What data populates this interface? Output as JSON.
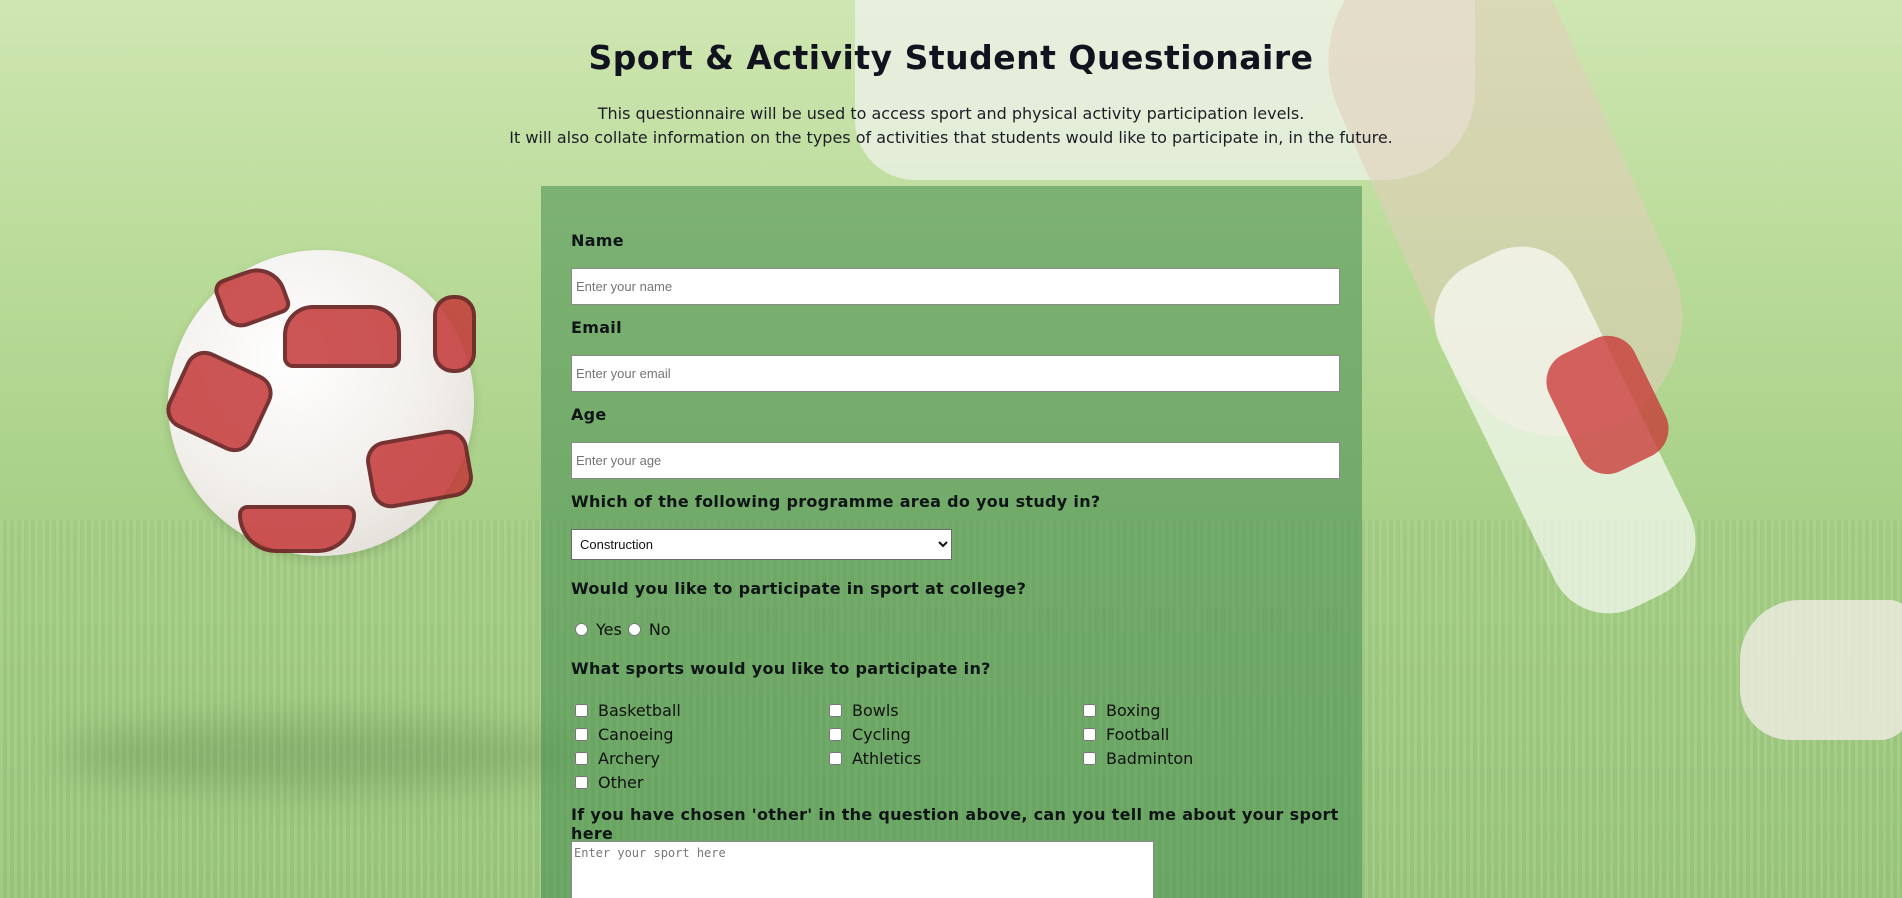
{
  "header": {
    "title": "Sport & Activity Student Questionaire",
    "subtitle_line1": "This questionnaire will be used to access sport and physical activity participation levels.",
    "subtitle_line2": "It will also collate information on the types of activities that students would like to participate in, in the future."
  },
  "form": {
    "name": {
      "label": "Name",
      "placeholder": "Enter your name"
    },
    "email": {
      "label": "Email",
      "placeholder": "Enter your email"
    },
    "age": {
      "label": "Age",
      "placeholder": "Enter your age"
    },
    "programme": {
      "label": "Which of the following programme area do you study in?",
      "selected": "Construction"
    },
    "participate": {
      "label": "Would you like to participate in sport at college?",
      "options": [
        "Yes",
        "No"
      ]
    },
    "sports": {
      "label": "What sports would you like to participate in?",
      "options": [
        "Basketball",
        "Bowls",
        "Boxing",
        "Canoeing",
        "Cycling",
        "Football",
        "Archery",
        "Athletics",
        "Badminton",
        "Other"
      ]
    },
    "other": {
      "label": "If you have chosen 'other' in the question above, can you tell me about your sport here",
      "placeholder": "Enter your sport here"
    }
  }
}
